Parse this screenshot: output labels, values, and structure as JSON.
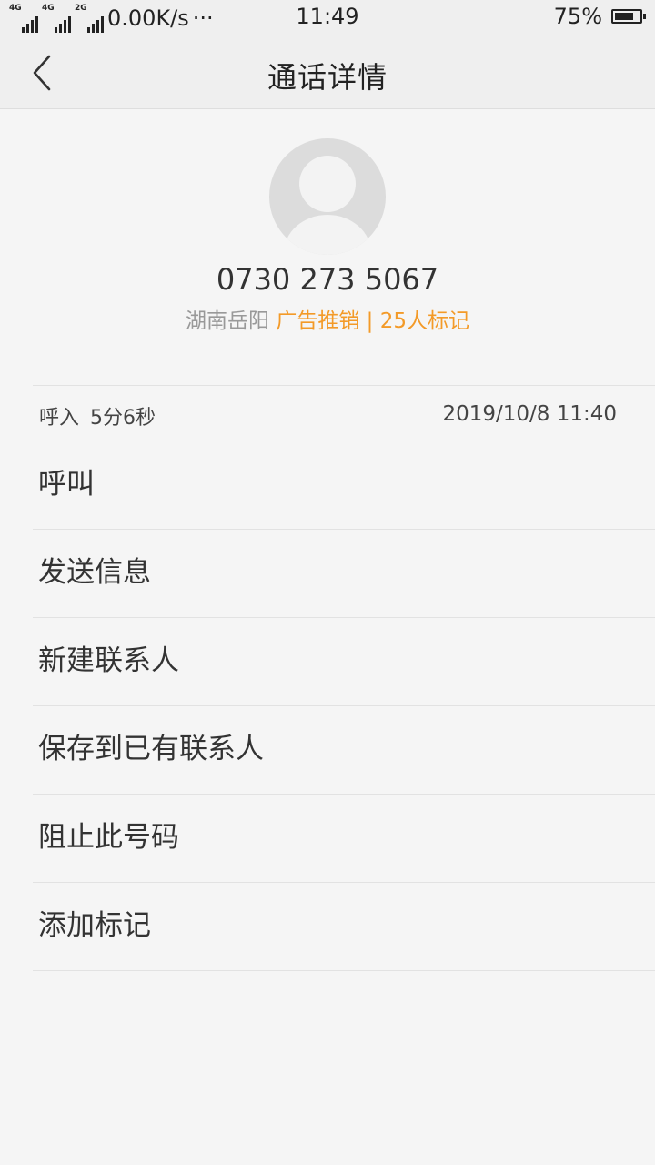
{
  "status_bar": {
    "network_1": "4G",
    "network_2": "4G",
    "network_3": "2G",
    "speed": "0.00K/s",
    "more": "···",
    "time": "11:49",
    "battery_percent": "75%",
    "battery_level": 0.75
  },
  "header": {
    "title": "通话详情"
  },
  "contact": {
    "number": "0730 273 5067",
    "location": "湖南岳阳",
    "tag_text": "广告推销 | 25人标记"
  },
  "record": {
    "type": "呼入",
    "duration": "5分6秒",
    "datetime": "2019/10/8 11:40"
  },
  "actions": [
    {
      "label": "呼叫"
    },
    {
      "label": "发送信息"
    },
    {
      "label": "新建联系人"
    },
    {
      "label": "保存到已有联系人"
    },
    {
      "label": "阻止此号码"
    },
    {
      "label": "添加标记"
    }
  ],
  "colors": {
    "accent_tag": "#f39a28",
    "background": "#f5f5f5",
    "divider": "#e2e2e2"
  }
}
